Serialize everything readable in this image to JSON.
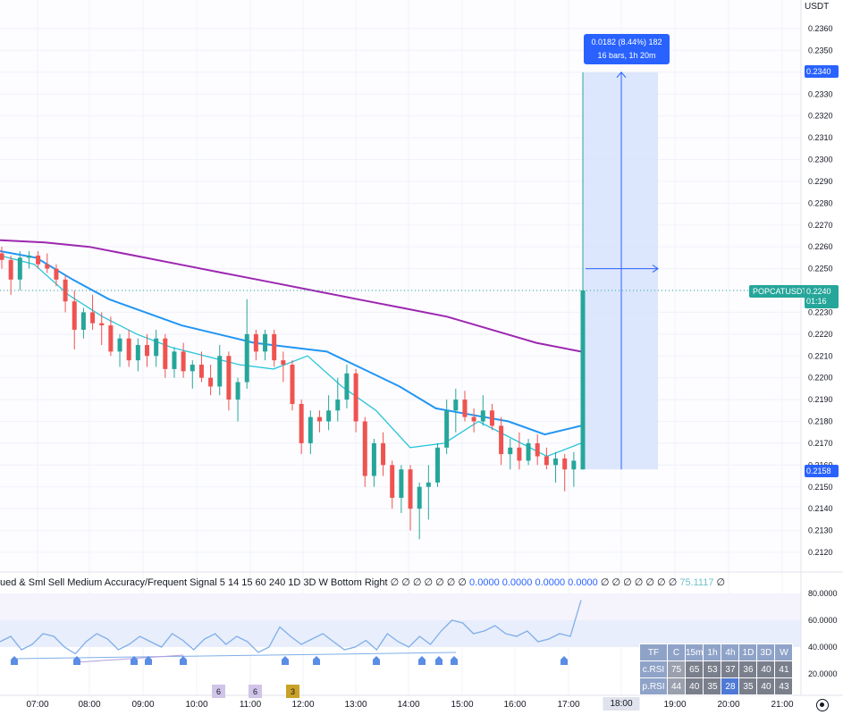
{
  "currency_label": "USDT",
  "symbol": "POPCATUSDT.P",
  "last_price": "0.2240",
  "countdown": "01:16",
  "measure": {
    "line1": "0.0182 (8.44%) 182",
    "line2": "16 bars, 1h 20m",
    "top_price": "0.2340",
    "bottom_price": "0.2158"
  },
  "price_axis": [
    "0.2360",
    "0.2350",
    "0.2340",
    "0.2330",
    "0.2320",
    "0.2310",
    "0.2300",
    "0.2290",
    "0.2280",
    "0.2270",
    "0.2260",
    "0.2250",
    "0.2240",
    "0.2230",
    "0.2220",
    "0.2210",
    "0.2200",
    "0.2190",
    "0.2180",
    "0.2170",
    "0.2160",
    "0.2150",
    "0.2140",
    "0.2130",
    "0.2120"
  ],
  "time_axis": [
    "07:00",
    "08:00",
    "09:00",
    "10:00",
    "11:00",
    "12:00",
    "13:00",
    "14:00",
    "15:00",
    "16:00",
    "17:00",
    "18:00",
    "19:00",
    "20:00",
    "21:00"
  ],
  "time_axis_highlight": "18:00",
  "indicator_legend": {
    "text": "ued & Sml Sell Medium Accuracy/Frequent Signal 5 14 15 60 240 1D 3D W Bottom Right",
    "dashes": "∅ ∅ ∅ ∅ ∅ ∅ ∅",
    "values_blue": "0.0000 0.0000 0.0000 0.0000",
    "dashes2": "∅ ∅ ∅ ∅ ∅ ∅ ∅",
    "value_cyan": "75.1117",
    "tail": "∅"
  },
  "rsi_axis": [
    "80.0000",
    "60.0000",
    "40.0000",
    "20.0000"
  ],
  "rsi_table": {
    "header": [
      "TF",
      "C",
      "15m",
      "1h",
      "4h",
      "1D",
      "3D",
      "W"
    ],
    "rows": [
      {
        "label": "c.RSI",
        "values": [
          "75",
          "65",
          "53",
          "37",
          "36",
          "40",
          "41"
        ]
      },
      {
        "label": "p.RSI",
        "values": [
          "44",
          "40",
          "35",
          "28",
          "35",
          "40",
          "43"
        ]
      }
    ]
  },
  "badges": [
    {
      "text": "6",
      "color": "#d1c4e9"
    },
    {
      "text": "6",
      "color": "#d1c4e9"
    },
    {
      "text": "3",
      "color": "#c9a227"
    }
  ],
  "colors": {
    "up": "#26a69a",
    "down": "#ef5350",
    "ma_purple": "#9c27b0",
    "ma_blue": "#2196f3",
    "ma_cyan": "#26c6da",
    "measure_fill": "#d6e2fb",
    "measure_accent": "#2962ff"
  },
  "chart_data": {
    "type": "candlestick",
    "x_ticks": [
      "07:00",
      "08:00",
      "09:00",
      "10:00",
      "11:00",
      "12:00",
      "13:00",
      "14:00",
      "15:00",
      "16:00",
      "17:00"
    ],
    "candles": [
      {
        "o": 0.2257,
        "h": 0.226,
        "l": 0.225,
        "c": 0.2254
      },
      {
        "o": 0.2254,
        "h": 0.2256,
        "l": 0.2238,
        "c": 0.2245
      },
      {
        "o": 0.2245,
        "h": 0.2258,
        "l": 0.224,
        "c": 0.2255
      },
      {
        "o": 0.2255,
        "h": 0.2258,
        "l": 0.225,
        "c": 0.2256
      },
      {
        "o": 0.2256,
        "h": 0.2258,
        "l": 0.225,
        "c": 0.2252
      },
      {
        "o": 0.2252,
        "h": 0.2257,
        "l": 0.2248,
        "c": 0.225
      },
      {
        "o": 0.225,
        "h": 0.2252,
        "l": 0.2242,
        "c": 0.2245
      },
      {
        "o": 0.2245,
        "h": 0.2247,
        "l": 0.223,
        "c": 0.2235
      },
      {
        "o": 0.2235,
        "h": 0.224,
        "l": 0.2213,
        "c": 0.2222
      },
      {
        "o": 0.2222,
        "h": 0.2232,
        "l": 0.2218,
        "c": 0.223
      },
      {
        "o": 0.223,
        "h": 0.2238,
        "l": 0.2222,
        "c": 0.2225
      },
      {
        "o": 0.2225,
        "h": 0.223,
        "l": 0.2215,
        "c": 0.2224
      },
      {
        "o": 0.2224,
        "h": 0.2228,
        "l": 0.221,
        "c": 0.2212
      },
      {
        "o": 0.2212,
        "h": 0.222,
        "l": 0.2205,
        "c": 0.2218
      },
      {
        "o": 0.2218,
        "h": 0.2222,
        "l": 0.2205,
        "c": 0.2208
      },
      {
        "o": 0.2208,
        "h": 0.2218,
        "l": 0.2203,
        "c": 0.2215
      },
      {
        "o": 0.2215,
        "h": 0.222,
        "l": 0.2205,
        "c": 0.221
      },
      {
        "o": 0.221,
        "h": 0.2222,
        "l": 0.2205,
        "c": 0.2218
      },
      {
        "o": 0.2218,
        "h": 0.222,
        "l": 0.22,
        "c": 0.2204
      },
      {
        "o": 0.2204,
        "h": 0.2214,
        "l": 0.22,
        "c": 0.2212
      },
      {
        "o": 0.2212,
        "h": 0.2216,
        "l": 0.22,
        "c": 0.2203
      },
      {
        "o": 0.2203,
        "h": 0.2208,
        "l": 0.2195,
        "c": 0.2206
      },
      {
        "o": 0.2206,
        "h": 0.2212,
        "l": 0.2198,
        "c": 0.22
      },
      {
        "o": 0.22,
        "h": 0.2206,
        "l": 0.2192,
        "c": 0.2196
      },
      {
        "o": 0.2196,
        "h": 0.2215,
        "l": 0.2192,
        "c": 0.221
      },
      {
        "o": 0.221,
        "h": 0.2212,
        "l": 0.2185,
        "c": 0.219
      },
      {
        "o": 0.219,
        "h": 0.22,
        "l": 0.218,
        "c": 0.2198
      },
      {
        "o": 0.2198,
        "h": 0.2236,
        "l": 0.2195,
        "c": 0.222
      },
      {
        "o": 0.222,
        "h": 0.2222,
        "l": 0.2208,
        "c": 0.2212
      },
      {
        "o": 0.2212,
        "h": 0.2222,
        "l": 0.2208,
        "c": 0.222
      },
      {
        "o": 0.222,
        "h": 0.2222,
        "l": 0.2205,
        "c": 0.2208
      },
      {
        "o": 0.2208,
        "h": 0.2212,
        "l": 0.2198,
        "c": 0.2206
      },
      {
        "o": 0.2206,
        "h": 0.2208,
        "l": 0.2185,
        "c": 0.2188
      },
      {
        "o": 0.2188,
        "h": 0.219,
        "l": 0.2165,
        "c": 0.217
      },
      {
        "o": 0.217,
        "h": 0.2185,
        "l": 0.2165,
        "c": 0.2182
      },
      {
        "o": 0.2182,
        "h": 0.2185,
        "l": 0.2175,
        "c": 0.218
      },
      {
        "o": 0.218,
        "h": 0.2192,
        "l": 0.2176,
        "c": 0.2185
      },
      {
        "o": 0.2185,
        "h": 0.22,
        "l": 0.218,
        "c": 0.219
      },
      {
        "o": 0.219,
        "h": 0.2206,
        "l": 0.2186,
        "c": 0.2202
      },
      {
        "o": 0.2202,
        "h": 0.2204,
        "l": 0.2175,
        "c": 0.218
      },
      {
        "o": 0.218,
        "h": 0.2182,
        "l": 0.215,
        "c": 0.2155
      },
      {
        "o": 0.2155,
        "h": 0.2172,
        "l": 0.215,
        "c": 0.217
      },
      {
        "o": 0.217,
        "h": 0.2175,
        "l": 0.2155,
        "c": 0.216
      },
      {
        "o": 0.216,
        "h": 0.2162,
        "l": 0.214,
        "c": 0.2145
      },
      {
        "o": 0.2145,
        "h": 0.216,
        "l": 0.2138,
        "c": 0.2158
      },
      {
        "o": 0.2158,
        "h": 0.216,
        "l": 0.213,
        "c": 0.214
      },
      {
        "o": 0.214,
        "h": 0.2152,
        "l": 0.2126,
        "c": 0.215
      },
      {
        "o": 0.215,
        "h": 0.216,
        "l": 0.2135,
        "c": 0.2152
      },
      {
        "o": 0.2152,
        "h": 0.217,
        "l": 0.215,
        "c": 0.2168
      },
      {
        "o": 0.2168,
        "h": 0.219,
        "l": 0.2165,
        "c": 0.2185
      },
      {
        "o": 0.2185,
        "h": 0.2195,
        "l": 0.2175,
        "c": 0.219
      },
      {
        "o": 0.219,
        "h": 0.2194,
        "l": 0.218,
        "c": 0.2182
      },
      {
        "o": 0.2182,
        "h": 0.2186,
        "l": 0.2175,
        "c": 0.218
      },
      {
        "o": 0.218,
        "h": 0.2192,
        "l": 0.2178,
        "c": 0.2185
      },
      {
        "o": 0.2185,
        "h": 0.2188,
        "l": 0.2176,
        "c": 0.2178
      },
      {
        "o": 0.2178,
        "h": 0.2182,
        "l": 0.216,
        "c": 0.2165
      },
      {
        "o": 0.2165,
        "h": 0.2172,
        "l": 0.2158,
        "c": 0.2168
      },
      {
        "o": 0.2168,
        "h": 0.2175,
        "l": 0.2158,
        "c": 0.2162
      },
      {
        "o": 0.2162,
        "h": 0.2172,
        "l": 0.216,
        "c": 0.217
      },
      {
        "o": 0.217,
        "h": 0.2174,
        "l": 0.216,
        "c": 0.2164
      },
      {
        "o": 0.2164,
        "h": 0.2168,
        "l": 0.2158,
        "c": 0.216
      },
      {
        "o": 0.216,
        "h": 0.2166,
        "l": 0.2152,
        "c": 0.2163
      },
      {
        "o": 0.2163,
        "h": 0.2165,
        "l": 0.2148,
        "c": 0.2158
      },
      {
        "o": 0.2158,
        "h": 0.2166,
        "l": 0.215,
        "c": 0.2162
      },
      {
        "o": 0.2158,
        "h": 0.234,
        "l": 0.2158,
        "c": 0.224
      }
    ],
    "ma_purple": [
      0.2263,
      0.2262,
      0.226,
      0.2256,
      0.2252,
      0.2248,
      0.2244,
      0.224,
      0.2236,
      0.2232,
      0.2228,
      0.2222,
      0.2216,
      0.2212
    ],
    "ma_blue": [
      0.2258,
      0.2255,
      0.2245,
      0.2236,
      0.223,
      0.2224,
      0.222,
      0.2216,
      0.2214,
      0.2212,
      0.2204,
      0.2196,
      0.2186,
      0.2183,
      0.218,
      0.2174,
      0.2178
    ],
    "ma_cyan": [
      0.2256,
      0.2252,
      0.2238,
      0.2228,
      0.222,
      0.2214,
      0.221,
      0.2206,
      0.2204,
      0.221,
      0.2196,
      0.2185,
      0.2168,
      0.217,
      0.218,
      0.2172,
      0.2164,
      0.217
    ],
    "ylim": [
      0.2115,
      0.2365
    ]
  }
}
